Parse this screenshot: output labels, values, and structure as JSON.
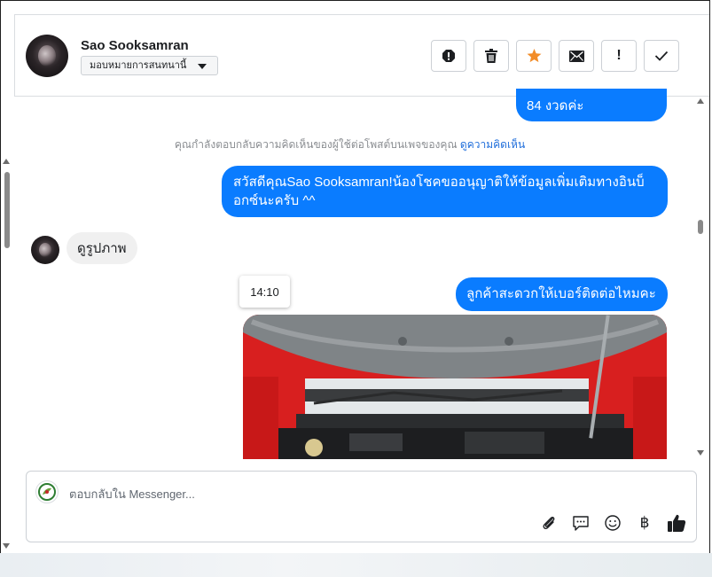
{
  "header": {
    "contact_name": "Sao Sooksamran",
    "assign_label": "มอบหมายการสนทนานี้",
    "toolbar": [
      {
        "name": "spam-button",
        "icon": "alert-circle-icon"
      },
      {
        "name": "delete-button",
        "icon": "trash-icon"
      },
      {
        "name": "star-button",
        "icon": "star-icon",
        "color": "#f28c28"
      },
      {
        "name": "mark-unread-button",
        "icon": "envelope-icon"
      },
      {
        "name": "follow-up-button",
        "icon": "exclamation-icon",
        "glyph": "!"
      },
      {
        "name": "mark-done-button",
        "icon": "check-icon"
      }
    ]
  },
  "messages": {
    "out_1": "84 งวดค่ะ",
    "system_note": "คุณกำลังตอบกลับความคิดเห็นของผู้ใช้ต่อโพสต์บนเพจของคุณ",
    "system_link": "ดูความคิดเห็น",
    "out_2": "สวัสดีคุณSao Sooksamran!น้องโชคขออนุญาติให้ข้อมูลเพิ่มเติมทางอินบ็อกซ์นะครับ ^^",
    "in_1": "ดูรูปภาพ",
    "timestamp": "14:10",
    "out_3": "ลูกค้าสะดวกให้เบอร์ติดต่อไหมคะ"
  },
  "composer": {
    "placeholder": "ตอบกลับใน Messenger...",
    "icons": [
      "paperclip-icon",
      "saved-reply-icon",
      "emoji-icon",
      "baht-icon",
      "thumbs-up-icon"
    ],
    "baht_glyph": "฿"
  },
  "colors": {
    "bubble_out": "#0a7cff",
    "bubble_in": "#f0f0f0",
    "link": "#216fdb",
    "star": "#f28c28"
  }
}
